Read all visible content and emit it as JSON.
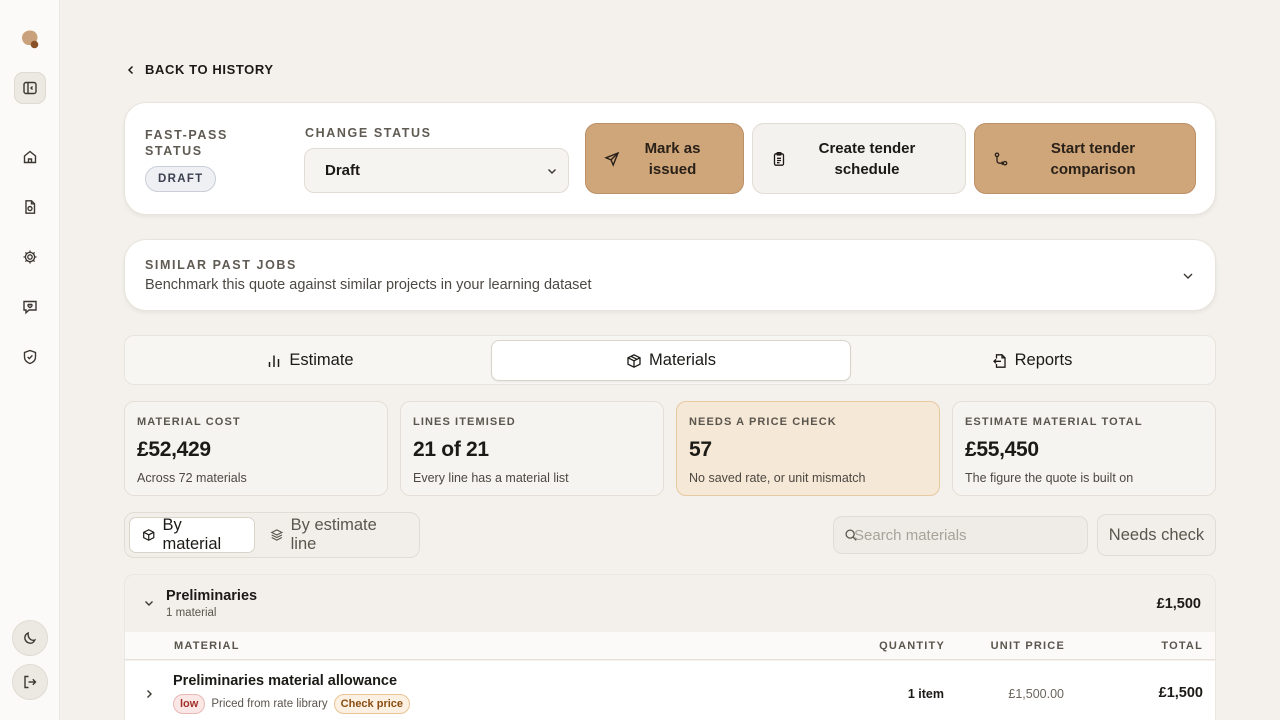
{
  "colors": {
    "accent": "#cfa57a",
    "page_bg": "#f4f1ec",
    "warn_bg": "#f5e8d6"
  },
  "sidebar": {
    "icons": [
      "logo-icon",
      "panel-toggle-icon",
      "home-icon",
      "document-icon",
      "settings-icon",
      "chat-icon",
      "shield-icon",
      "moon-icon",
      "logout-icon"
    ]
  },
  "nav": {
    "back_label": "BACK TO HISTORY"
  },
  "status": {
    "fast_pass_label": "FAST-PASS STATUS",
    "fast_pass_value": "DRAFT",
    "change_status_label": "CHANGE STATUS",
    "selected_status": "Draft",
    "actions": {
      "mark_issued": "Mark as issued",
      "create_tender": "Create tender schedule",
      "start_comparison": "Start tender comparison"
    }
  },
  "similar_jobs": {
    "title": "SIMILAR PAST JOBS",
    "subtitle": "Benchmark this quote against similar projects in your learning dataset"
  },
  "tabs": {
    "estimate": "Estimate",
    "materials": "Materials",
    "reports": "Reports",
    "active": "Materials"
  },
  "stats": [
    {
      "label": "MATERIAL COST",
      "value": "£52,429",
      "sub": "Across 72 materials"
    },
    {
      "label": "LINES ITEMISED",
      "value": "21 of 21",
      "sub": "Every line has a material list"
    },
    {
      "label": "NEEDS A PRICE CHECK",
      "value": "57",
      "sub": "No saved rate, or unit mismatch"
    },
    {
      "label": "ESTIMATE MATERIAL TOTAL",
      "value": "£55,450",
      "sub": "The figure the quote is built on"
    }
  ],
  "view_toggle": {
    "by_material": "By material",
    "by_line": "By estimate line",
    "active": "By material"
  },
  "search": {
    "placeholder": "Search materials",
    "value": ""
  },
  "filter": {
    "needs_check": "Needs check"
  },
  "group": {
    "title": "Preliminaries",
    "count": "1 material",
    "total": "£1,500",
    "columns": {
      "material": "MATERIAL",
      "quantity": "QUANTITY",
      "unit_price": "UNIT PRICE",
      "total": "TOTAL"
    },
    "rows": [
      {
        "name": "Preliminaries material allowance",
        "confidence": "low",
        "source": "Priced from rate library",
        "flag": "Check price",
        "quantity": "1 item",
        "unit_price": "£1,500.00",
        "total": "£1,500"
      }
    ]
  }
}
